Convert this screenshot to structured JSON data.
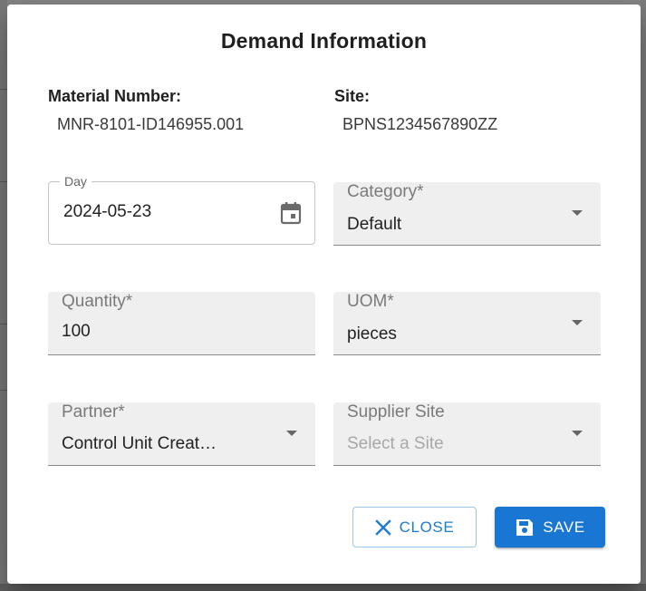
{
  "dialog": {
    "title": "Demand Information",
    "material": {
      "label": "Material Number:",
      "value": "MNR-8101-ID146955.001"
    },
    "site": {
      "label": "Site:",
      "value": "BPNS1234567890ZZ"
    }
  },
  "fields": {
    "day": {
      "label": "Day",
      "value": "2024-05-23"
    },
    "category": {
      "label": "Category*",
      "value": "Default"
    },
    "quantity": {
      "label": "Quantity*",
      "value": "100"
    },
    "uom": {
      "label": "UOM*",
      "value": "pieces"
    },
    "partner": {
      "label": "Partner*",
      "value": "Control Unit Creat…"
    },
    "supplier_site": {
      "label": "Supplier Site",
      "placeholder": "Select a Site"
    }
  },
  "actions": {
    "close_label": "Close",
    "save_label": "Save"
  },
  "colors": {
    "primary": "#1976d2",
    "field_bg": "#efefef"
  },
  "icons": [
    "calendar-icon",
    "dropdown-arrow-icon",
    "close-x-icon",
    "save-floppy-icon"
  ]
}
